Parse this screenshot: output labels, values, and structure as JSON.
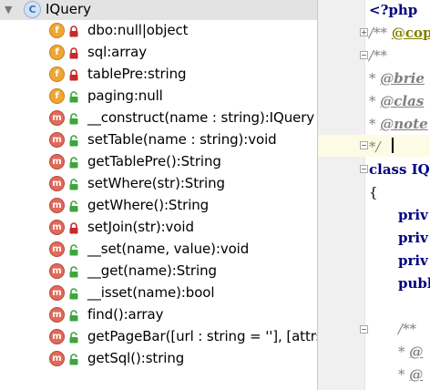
{
  "structure": {
    "root": {
      "label": "IQuery",
      "kind": "class",
      "icon_letter": "C",
      "expanded": true
    },
    "members": [
      {
        "kind": "f",
        "label": "dbo:null|object",
        "access": "private"
      },
      {
        "kind": "f",
        "label": "sql:array",
        "access": "private"
      },
      {
        "kind": "f",
        "label": "tablePre:string",
        "access": "private"
      },
      {
        "kind": "f",
        "label": "paging:null",
        "access": "public"
      },
      {
        "kind": "m",
        "label": "__construct(name : string):IQuery",
        "access": "public"
      },
      {
        "kind": "m",
        "label": "setTable(name : string):void",
        "access": "public"
      },
      {
        "kind": "m",
        "label": "getTablePre():String",
        "access": "public"
      },
      {
        "kind": "m",
        "label": "setWhere(str):String",
        "access": "public"
      },
      {
        "kind": "m",
        "label": "getWhere():String",
        "access": "public"
      },
      {
        "kind": "m",
        "label": "setJoin(str):void",
        "access": "private"
      },
      {
        "kind": "m",
        "label": "__set(name, value):void",
        "access": "public"
      },
      {
        "kind": "m",
        "label": "__get(name):String",
        "access": "public"
      },
      {
        "kind": "m",
        "label": "__isset(name):bool",
        "access": "public"
      },
      {
        "kind": "m",
        "label": "find():array",
        "access": "public"
      },
      {
        "kind": "m",
        "label": "getPageBar([url : string = ''], [attrs :",
        "access": "public"
      },
      {
        "kind": "m",
        "label": "getSql():string",
        "access": "public"
      }
    ]
  },
  "editor": {
    "lines": {
      "l1": "<?php",
      "l2_open": "/** ",
      "l2_tag": "@cop",
      "l3": "/**",
      "l4_star": " * ",
      "l4_tag": "@brie",
      "l5_star": " * ",
      "l5_tag": "@clas",
      "l6_star": " * ",
      "l6_tag": "@note",
      "l7": " */",
      "l8": "class IQ",
      "l9": "{",
      "l10": "priv",
      "l11": "priv",
      "l12": "priv",
      "l13": "publ",
      "l15": "/**",
      "l16_star": " * ",
      "l16_tag": "@",
      "l17_star": " * ",
      "l17_tag": "@"
    }
  },
  "colors": {
    "field_icon": "#f0a732",
    "method_icon": "#e06a5b",
    "lock_private": "#c62a2a",
    "lock_public": "#3ea53e",
    "keyword": "#000080",
    "comment": "#808080",
    "current_line": "#fcfce4"
  }
}
